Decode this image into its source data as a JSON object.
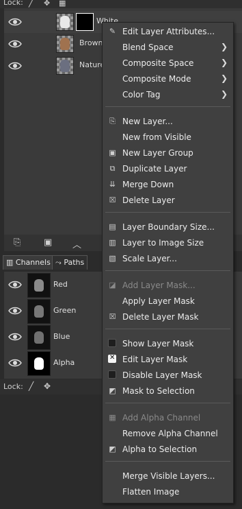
{
  "lockbar": {
    "label": "Lock:"
  },
  "layers": [
    {
      "name": "White",
      "thumb_color": "#e8e8e8",
      "selected": true
    },
    {
      "name": "Brown",
      "thumb_color": "#a0724f",
      "selected": false
    },
    {
      "name": "Nature",
      "thumb_color": "#6b6f80",
      "selected": false
    }
  ],
  "tabs": {
    "channels": "Channels",
    "paths": "Paths"
  },
  "channels": [
    {
      "name": "Red",
      "thumb_color": "#8a8a8a"
    },
    {
      "name": "Green",
      "thumb_color": "#777777"
    },
    {
      "name": "Blue",
      "thumb_color": "#707070"
    },
    {
      "name": "Alpha",
      "thumb_color": "#ffffff"
    }
  ],
  "bottom_lock": {
    "label": "Lock:"
  },
  "menu": {
    "items": [
      {
        "label": "Edit Layer Attributes...",
        "icon": "edit-attributes-icon",
        "glyph": "✎",
        "submenu": false,
        "disabled": false
      },
      {
        "label": "Blend Space",
        "icon": "",
        "glyph": "",
        "submenu": true,
        "disabled": false
      },
      {
        "label": "Composite Space",
        "icon": "",
        "glyph": "",
        "submenu": true,
        "disabled": false
      },
      {
        "label": "Composite Mode",
        "icon": "",
        "glyph": "",
        "submenu": true,
        "disabled": false
      },
      {
        "label": "Color Tag",
        "icon": "",
        "glyph": "",
        "submenu": true,
        "disabled": false
      },
      {
        "label": "New Layer...",
        "icon": "new-layer-icon",
        "glyph": "⎘",
        "submenu": false,
        "disabled": false
      },
      {
        "label": "New from Visible",
        "icon": "",
        "glyph": "",
        "submenu": false,
        "disabled": false
      },
      {
        "label": "New Layer Group",
        "icon": "new-layer-group-icon",
        "glyph": "▣",
        "submenu": false,
        "disabled": false
      },
      {
        "label": "Duplicate Layer",
        "icon": "duplicate-layer-icon",
        "glyph": "⧉",
        "submenu": false,
        "disabled": false
      },
      {
        "label": "Merge Down",
        "icon": "merge-down-icon",
        "glyph": "⇊",
        "submenu": false,
        "disabled": false
      },
      {
        "label": "Delete Layer",
        "icon": "delete-layer-icon",
        "glyph": "☒",
        "submenu": false,
        "disabled": false
      },
      {
        "label": "Layer Boundary Size...",
        "icon": "layer-boundary-icon",
        "glyph": "▤",
        "submenu": false,
        "disabled": false
      },
      {
        "label": "Layer to Image Size",
        "icon": "layer-to-image-icon",
        "glyph": "▥",
        "submenu": false,
        "disabled": false
      },
      {
        "label": "Scale Layer...",
        "icon": "scale-layer-icon",
        "glyph": "▧",
        "submenu": false,
        "disabled": false
      },
      {
        "label": "Add Layer Mask...",
        "icon": "add-mask-icon",
        "glyph": "◪",
        "submenu": false,
        "disabled": true
      },
      {
        "label": "Apply Layer Mask",
        "icon": "",
        "glyph": "",
        "submenu": false,
        "disabled": false
      },
      {
        "label": "Delete Layer Mask",
        "icon": "delete-mask-icon",
        "glyph": "☒",
        "submenu": false,
        "disabled": false
      },
      {
        "label": "Show Layer Mask",
        "icon": "checkbox-icon",
        "glyph": "",
        "submenu": false,
        "disabled": false,
        "check": "off"
      },
      {
        "label": "Edit Layer Mask",
        "icon": "checkbox-checked-icon",
        "glyph": "",
        "submenu": false,
        "disabled": false,
        "check": "on"
      },
      {
        "label": "Disable Layer Mask",
        "icon": "checkbox-icon",
        "glyph": "",
        "submenu": false,
        "disabled": false,
        "check": "off"
      },
      {
        "label": "Mask to Selection",
        "icon": "mask-to-selection-icon",
        "glyph": "◩",
        "submenu": false,
        "disabled": false
      },
      {
        "label": "Add Alpha Channel",
        "icon": "add-alpha-icon",
        "glyph": "▦",
        "submenu": false,
        "disabled": true
      },
      {
        "label": "Remove Alpha Channel",
        "icon": "",
        "glyph": "",
        "submenu": false,
        "disabled": false
      },
      {
        "label": "Alpha to Selection",
        "icon": "alpha-to-selection-icon",
        "glyph": "◩",
        "submenu": false,
        "disabled": false
      },
      {
        "label": "Merge Visible Layers...",
        "icon": "",
        "glyph": "",
        "submenu": false,
        "disabled": false
      },
      {
        "label": "Flatten Image",
        "icon": "",
        "glyph": "",
        "submenu": false,
        "disabled": false
      }
    ]
  }
}
